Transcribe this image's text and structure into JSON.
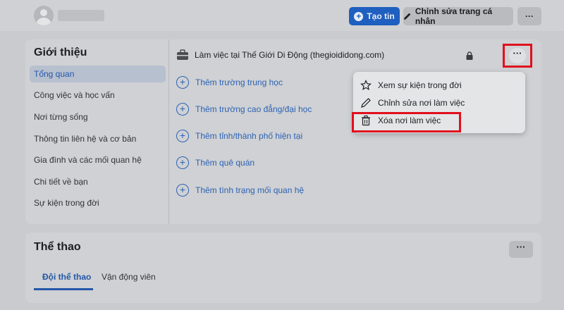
{
  "header": {
    "create_story_label": "Tạo tin",
    "edit_profile_label": "Chỉnh sửa trang cá nhân",
    "more_label": "···"
  },
  "intro": {
    "title": "Giới thiệu",
    "sidebar": [
      {
        "label": "Tổng quan",
        "active": true
      },
      {
        "label": "Công việc và học vấn"
      },
      {
        "label": "Nơi từng sống"
      },
      {
        "label": "Thông tin liên hệ và cơ bản"
      },
      {
        "label": "Gia đình và các mối quan hệ"
      },
      {
        "label": "Chi tiết về bạn"
      },
      {
        "label": "Sự kiện trong đời"
      }
    ],
    "work": "Làm việc tại Thế Giới Di Động (thegioididong.com)",
    "more_label": "···",
    "add_items": [
      "Thêm trường trung học",
      "Thêm trường cao đẳng/đại học",
      "Thêm tỉnh/thành phố hiện tại",
      "Thêm quê quán",
      "Thêm tình trạng mối quan hệ"
    ]
  },
  "menu": {
    "items": [
      {
        "label": "Xem sự kiện trong đời",
        "icon": "star-icon"
      },
      {
        "label": "Chỉnh sửa nơi làm việc",
        "icon": "pencil-icon"
      },
      {
        "label": "Xóa nơi làm việc",
        "icon": "trash-icon"
      }
    ]
  },
  "sports": {
    "title": "Thể thao",
    "more_label": "···",
    "tabs": [
      {
        "label": "Đội thể thao",
        "active": true
      },
      {
        "label": "Vận động viên"
      }
    ]
  },
  "colors": {
    "accent": "#2457a8",
    "highlight_border": "#e0101d",
    "primary_button": "#1f5fbf"
  }
}
